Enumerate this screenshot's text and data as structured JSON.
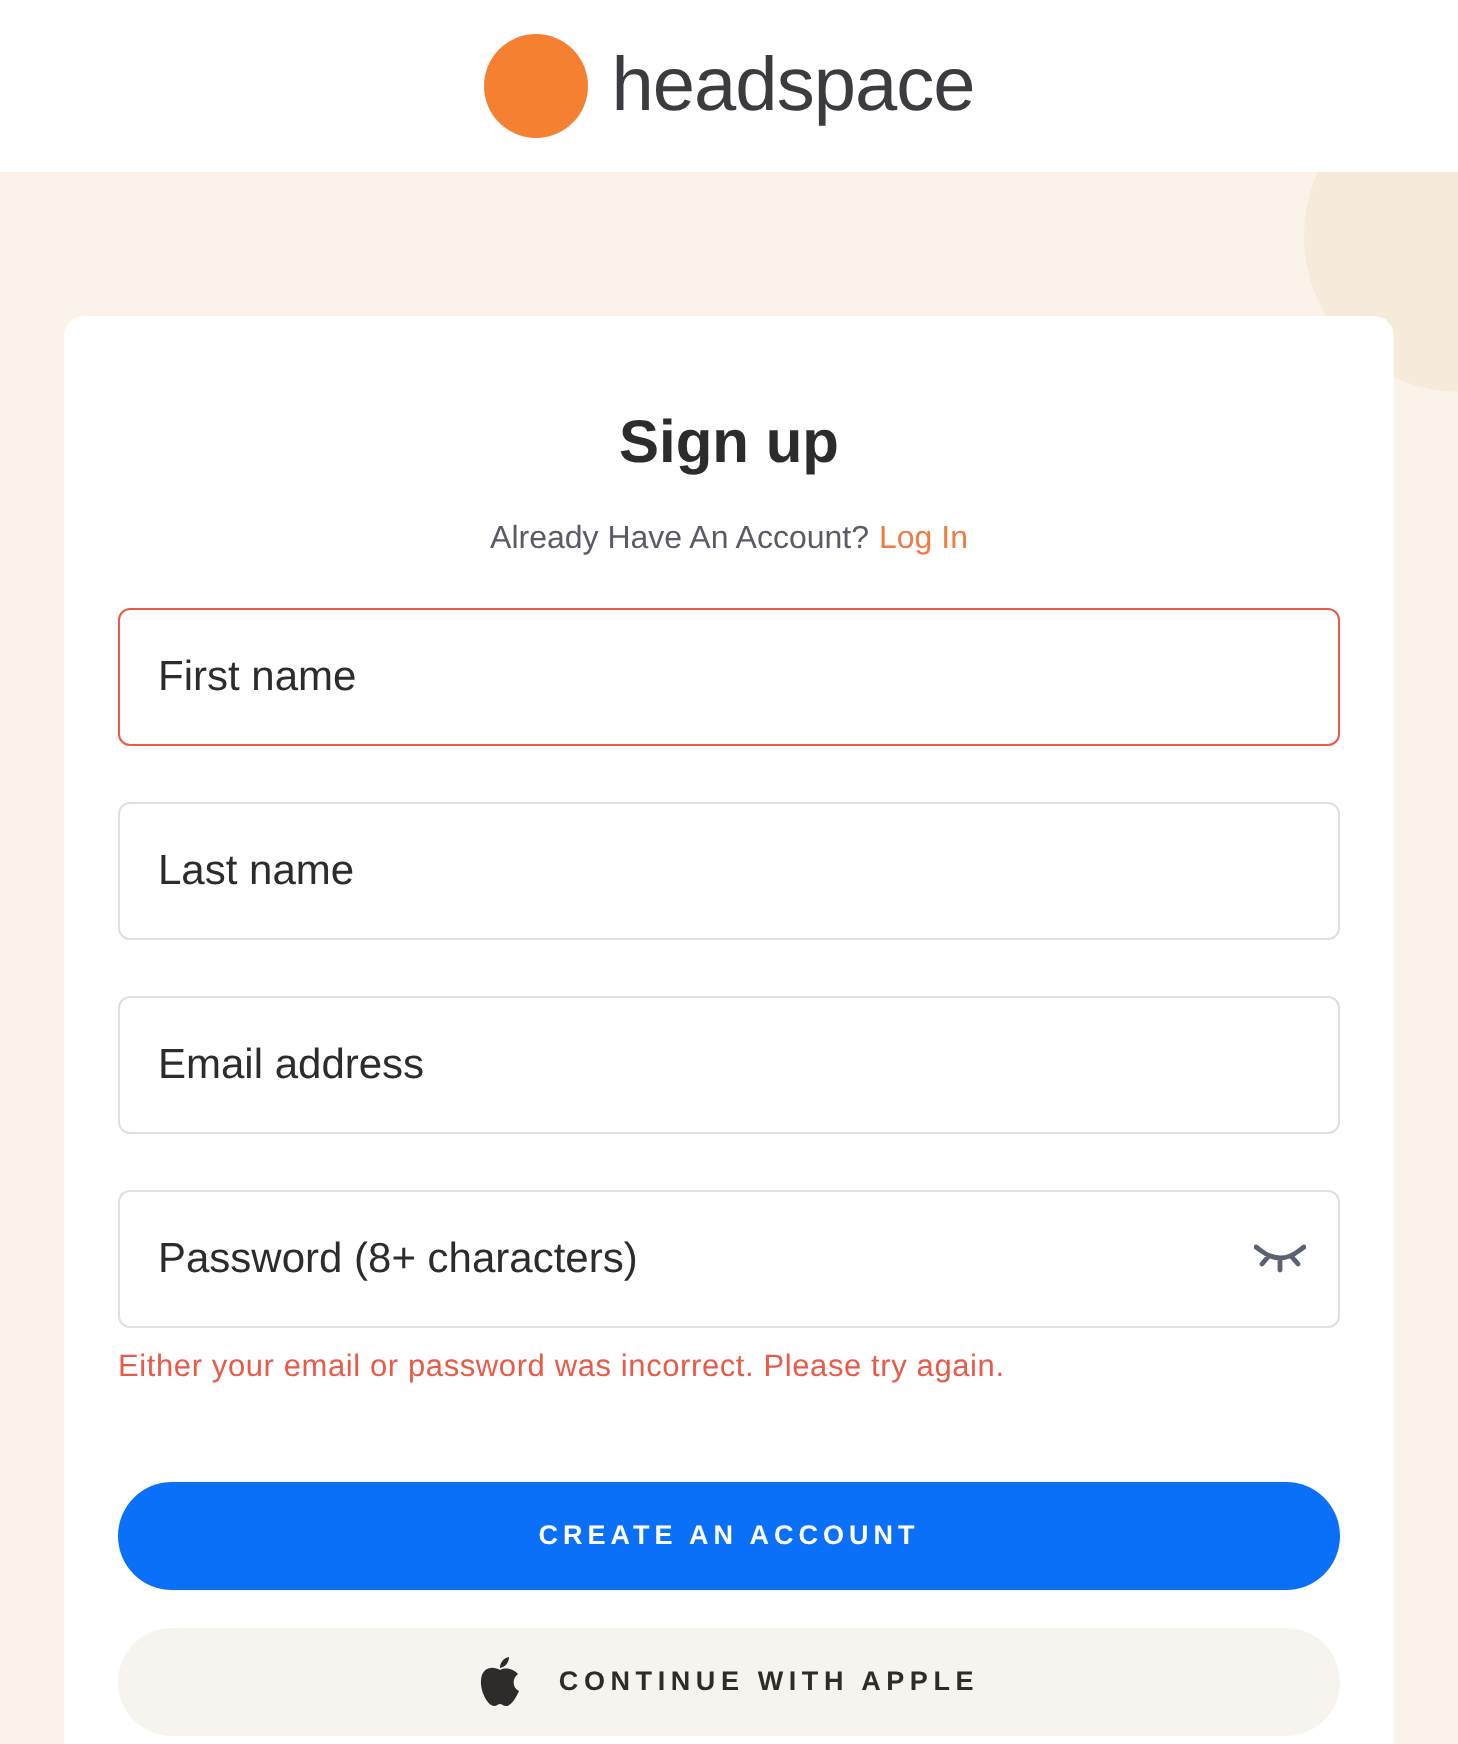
{
  "header": {
    "logo_text": "headspace"
  },
  "form": {
    "title": "Sign up",
    "account_prompt": "Already Have An Account?",
    "login_link": "Log In",
    "fields": [
      {
        "kind": "text",
        "placeholder": "First name",
        "invalid": true
      },
      {
        "kind": "text",
        "placeholder": "Last name",
        "invalid": false
      },
      {
        "kind": "email",
        "placeholder": "Email address",
        "invalid": false
      },
      {
        "kind": "password",
        "placeholder": "Password (8+ characters)",
        "invalid": false
      }
    ],
    "error_message": "Either your email or password was incorrect. Please try again.",
    "buttons": [
      {
        "kind": "primary",
        "label": "CREATE AN ACCOUNT"
      },
      {
        "kind": "apple",
        "label": "CONTINUE WITH APPLE"
      }
    ]
  }
}
